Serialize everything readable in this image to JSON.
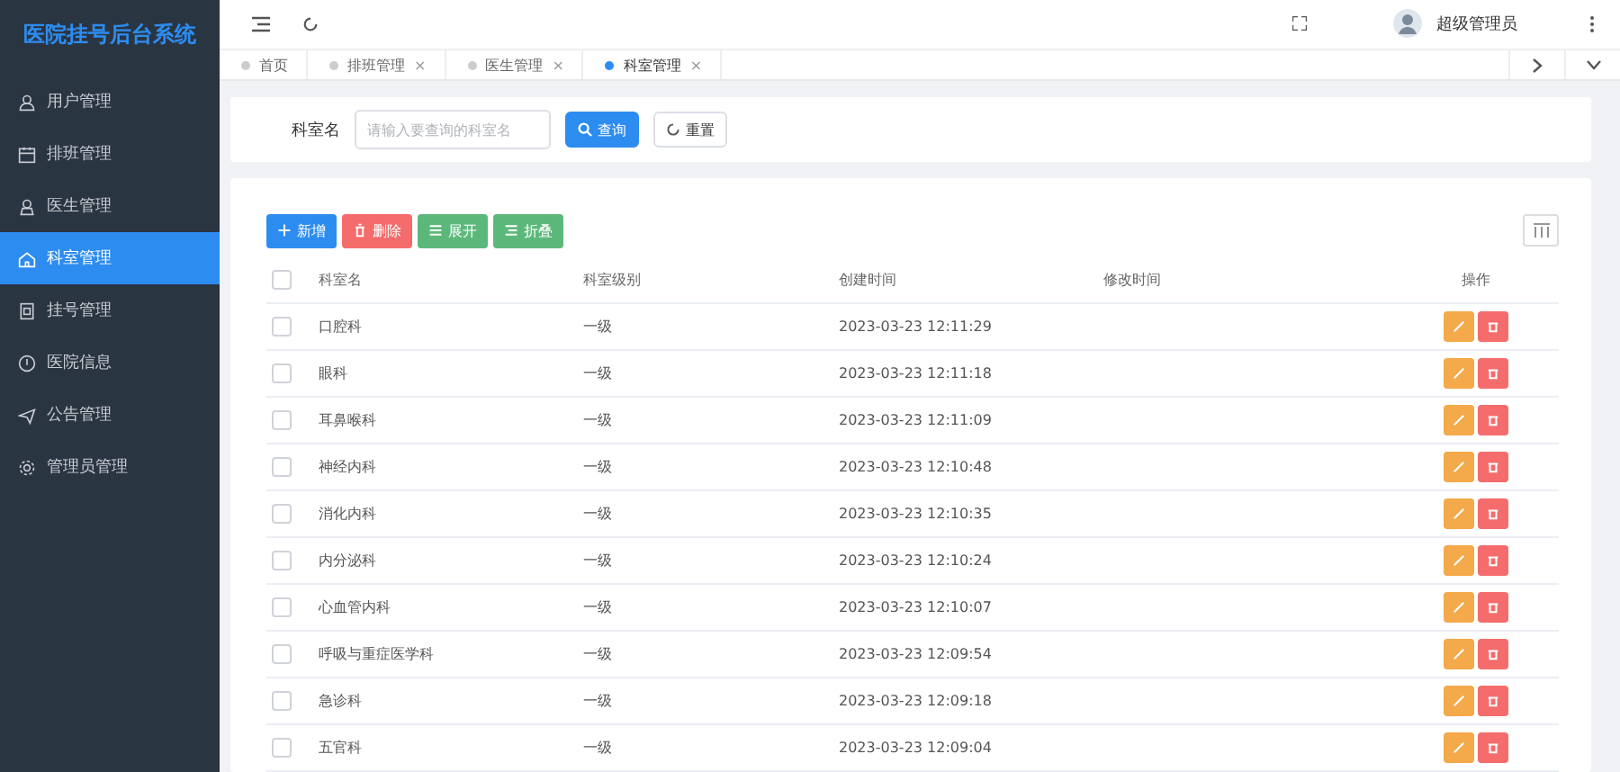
{
  "sidebar": {
    "title": "医院挂号后台系统",
    "items": [
      {
        "label": "用户管理",
        "selected": false
      },
      {
        "label": "排班管理",
        "selected": false
      },
      {
        "label": "医生管理",
        "selected": false
      },
      {
        "label": "科室管理",
        "selected": true
      },
      {
        "label": "挂号管理",
        "selected": false
      },
      {
        "label": "医院信息",
        "selected": false
      },
      {
        "label": "公告管理",
        "selected": false
      },
      {
        "label": "管理员管理",
        "selected": false
      }
    ]
  },
  "header": {
    "user": "超级管理员"
  },
  "tabs": [
    {
      "label": "首页",
      "selected": false
    },
    {
      "label": "排班管理",
      "selected": false,
      "close": "×"
    },
    {
      "label": "医生管理",
      "selected": false,
      "close": "×"
    },
    {
      "label": "科室管理",
      "selected": true,
      "close": "×"
    }
  ],
  "search": {
    "label": "科室名",
    "placeholder": "请输入要查询的科室名",
    "buttons": [
      "查询",
      "重置"
    ]
  },
  "toolbar": [
    {
      "kind": "add",
      "label": "新增"
    },
    {
      "kind": "delete",
      "label": "删除"
    },
    {
      "kind": "expand",
      "label": "展开"
    },
    {
      "kind": "collapse",
      "label": "折叠"
    }
  ],
  "table": {
    "all_checked": false,
    "columns": [
      "科室名",
      "科室级别",
      "创建时间",
      "修改时间",
      "操作"
    ],
    "rows": [
      {
        "name": "口腔科",
        "level": "一级",
        "created": "2023-03-23 12:11:29",
        "checked": false
      },
      {
        "name": "眼科",
        "level": "一级",
        "created": "2023-03-23 12:11:18",
        "checked": false
      },
      {
        "name": "耳鼻喉科",
        "level": "一级",
        "created": "2023-03-23 12:11:09",
        "checked": false
      },
      {
        "name": "神经内科",
        "level": "一级",
        "created": "2023-03-23 12:10:48",
        "checked": false
      },
      {
        "name": "消化内科",
        "level": "一级",
        "created": "2023-03-23 12:10:35",
        "checked": false
      },
      {
        "name": "内分泌科",
        "level": "一级",
        "created": "2023-03-23 12:10:24",
        "checked": false
      },
      {
        "name": "心血管内科",
        "level": "一级",
        "created": "2023-03-23 12:10:07",
        "checked": false
      },
      {
        "name": "呼吸与重症医学科",
        "level": "一级",
        "created": "2023-03-23 12:09:54",
        "checked": false
      },
      {
        "name": "急诊科",
        "level": "一级",
        "created": "2023-03-23 12:09:18",
        "checked": false
      },
      {
        "name": "五官科",
        "level": "一级",
        "created": "2023-03-23 12:09:04",
        "checked": false
      }
    ]
  }
}
